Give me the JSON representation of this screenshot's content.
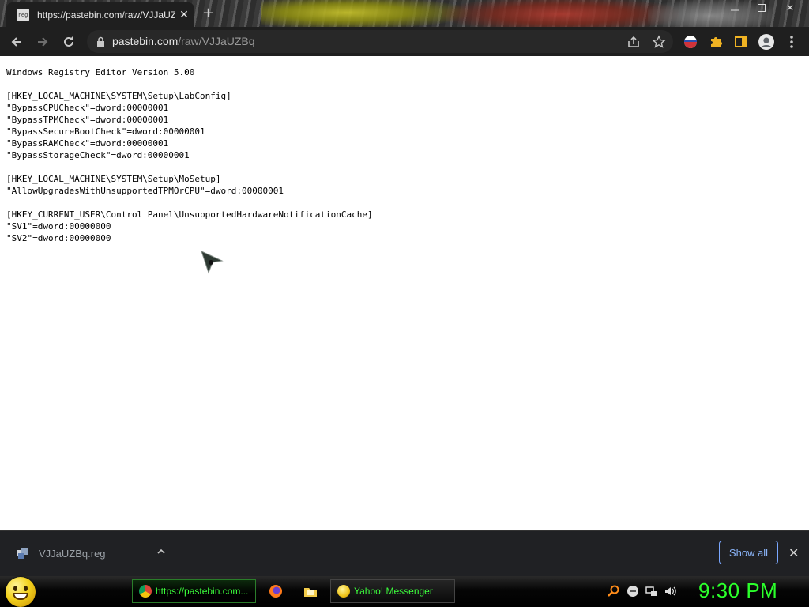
{
  "tab": {
    "title": "https://pastebin.com/raw/VJJaUZ",
    "favicon_text": "reg"
  },
  "address_bar": {
    "host": "pastebin.com",
    "path": "/raw/VJJaUZBq"
  },
  "page": {
    "lines": [
      "Windows Registry Editor Version 5.00",
      "",
      "[HKEY_LOCAL_MACHINE\\SYSTEM\\Setup\\LabConfig]",
      "\"BypassCPUCheck\"=dword:00000001",
      "\"BypassTPMCheck\"=dword:00000001",
      "\"BypassSecureBootCheck\"=dword:00000001",
      "\"BypassRAMCheck\"=dword:00000001",
      "\"BypassStorageCheck\"=dword:00000001",
      "",
      "[HKEY_LOCAL_MACHINE\\SYSTEM\\Setup\\MoSetup]",
      "\"AllowUpgradesWithUnsupportedTPMOrCPU\"=dword:00000001",
      "",
      "[HKEY_CURRENT_USER\\Control Panel\\UnsupportedHardwareNotificationCache]",
      "\"SV1\"=dword:00000000",
      "\"SV2\"=dword:00000000"
    ]
  },
  "downloads": {
    "file_name": "VJJaUZBq.reg",
    "show_all_label": "Show all"
  },
  "taskbar": {
    "chrome_label": "https://pastebin.com...",
    "yahoo_label": "Yahoo! Messenger",
    "clock": "9:30 PM"
  },
  "icons": {
    "back": "arrow-left-icon",
    "forward": "arrow-right-icon",
    "reload": "reload-icon",
    "lock": "lock-icon",
    "share": "share-icon",
    "bookmark": "star-icon",
    "extensions": "puzzle-icon",
    "profile": "avatar-icon"
  },
  "colors": {
    "taskbar_text": "#3cff3c",
    "clock": "#2bff2b",
    "show_all": "#8ab4f8"
  }
}
